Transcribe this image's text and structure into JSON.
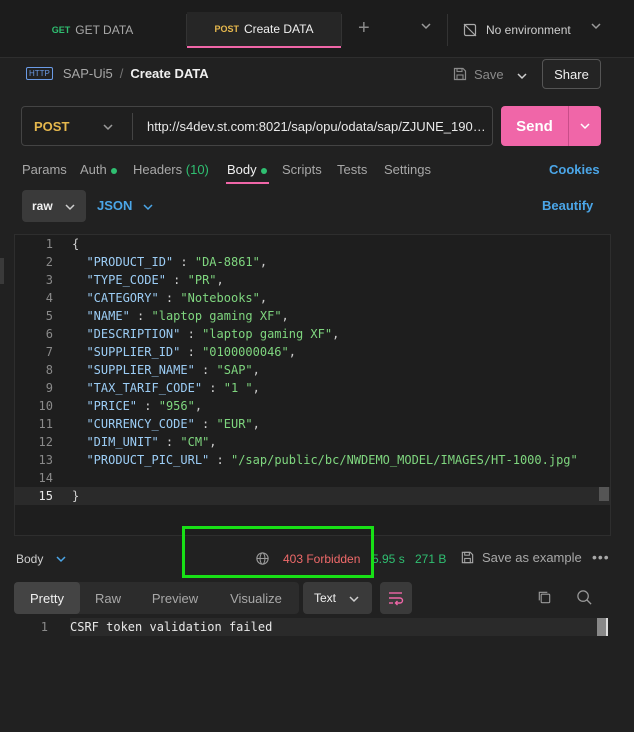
{
  "tabs": [
    {
      "method": "GET",
      "label": "GET DATA"
    },
    {
      "method": "POST",
      "label": "Create DATA"
    }
  ],
  "environment": "No environment",
  "breadcrumb": {
    "icon_text": "HTTP",
    "collection": "SAP-Ui5",
    "request": "Create DATA"
  },
  "actions": {
    "save": "Save",
    "share": "Share",
    "send": "Send"
  },
  "request": {
    "method": "POST",
    "url": "http://s4dev.st.com:8021/sap/opu/odata/sap/ZJUNE_1906..."
  },
  "request_tabs": {
    "params": "Params",
    "auth": "Auth",
    "headers": "Headers",
    "headers_count": "(10)",
    "body": "Body",
    "scripts": "Scripts",
    "tests": "Tests",
    "settings": "Settings",
    "cookies": "Cookies"
  },
  "body_options": {
    "mode": "raw",
    "language": "JSON",
    "beautify": "Beautify"
  },
  "editor_lines": [
    {
      "n": "1",
      "key": "",
      "val": "",
      "text": "{"
    },
    {
      "n": "2",
      "key": "\"PRODUCT_ID\"",
      "val": "\"DA-8861\"",
      "text": ""
    },
    {
      "n": "3",
      "key": "\"TYPE_CODE\"",
      "val": "\"PR\"",
      "text": ""
    },
    {
      "n": "4",
      "key": "\"CATEGORY\"",
      "val": "\"Notebooks\"",
      "text": ""
    },
    {
      "n": "5",
      "key": "\"NAME\"",
      "val": "\"laptop gaming XF\"",
      "text": ""
    },
    {
      "n": "6",
      "key": "\"DESCRIPTION\"",
      "val": "\"laptop gaming XF\"",
      "text": ""
    },
    {
      "n": "7",
      "key": "\"SUPPLIER_ID\"",
      "val": "\"0100000046\"",
      "text": ""
    },
    {
      "n": "8",
      "key": "\"SUPPLIER_NAME\"",
      "val": "\"SAP\"",
      "text": ""
    },
    {
      "n": "9",
      "key": "\"TAX_TARIF_CODE\"",
      "val": "\"1 \"",
      "text": ""
    },
    {
      "n": "10",
      "key": "\"PRICE\"",
      "val": "\"956\"",
      "text": ""
    },
    {
      "n": "11",
      "key": "\"CURRENCY_CODE\"",
      "val": "\"EUR\"",
      "text": ""
    },
    {
      "n": "12",
      "key": "\"DIM_UNIT\"",
      "val": "\"CM\"",
      "text": ""
    },
    {
      "n": "13",
      "key": "\"PRODUCT_PIC_URL\"",
      "val": "\"/sap/public/bc/NWDEMO_MODEL/IMAGES/HT-1000.jpg\"",
      "text": ""
    },
    {
      "n": "14",
      "key": "",
      "val": "",
      "text": ""
    },
    {
      "n": "15",
      "key": "",
      "val": "",
      "text": "}"
    }
  ],
  "response": {
    "section": "Body",
    "status": "403 Forbidden",
    "time": "5.95 s",
    "size": "271 B",
    "save_example": "Save as example",
    "views": [
      "Pretty",
      "Raw",
      "Preview",
      "Visualize"
    ],
    "format": "Text",
    "lines": [
      {
        "n": "1",
        "text": "CSRF token validation failed"
      }
    ]
  }
}
